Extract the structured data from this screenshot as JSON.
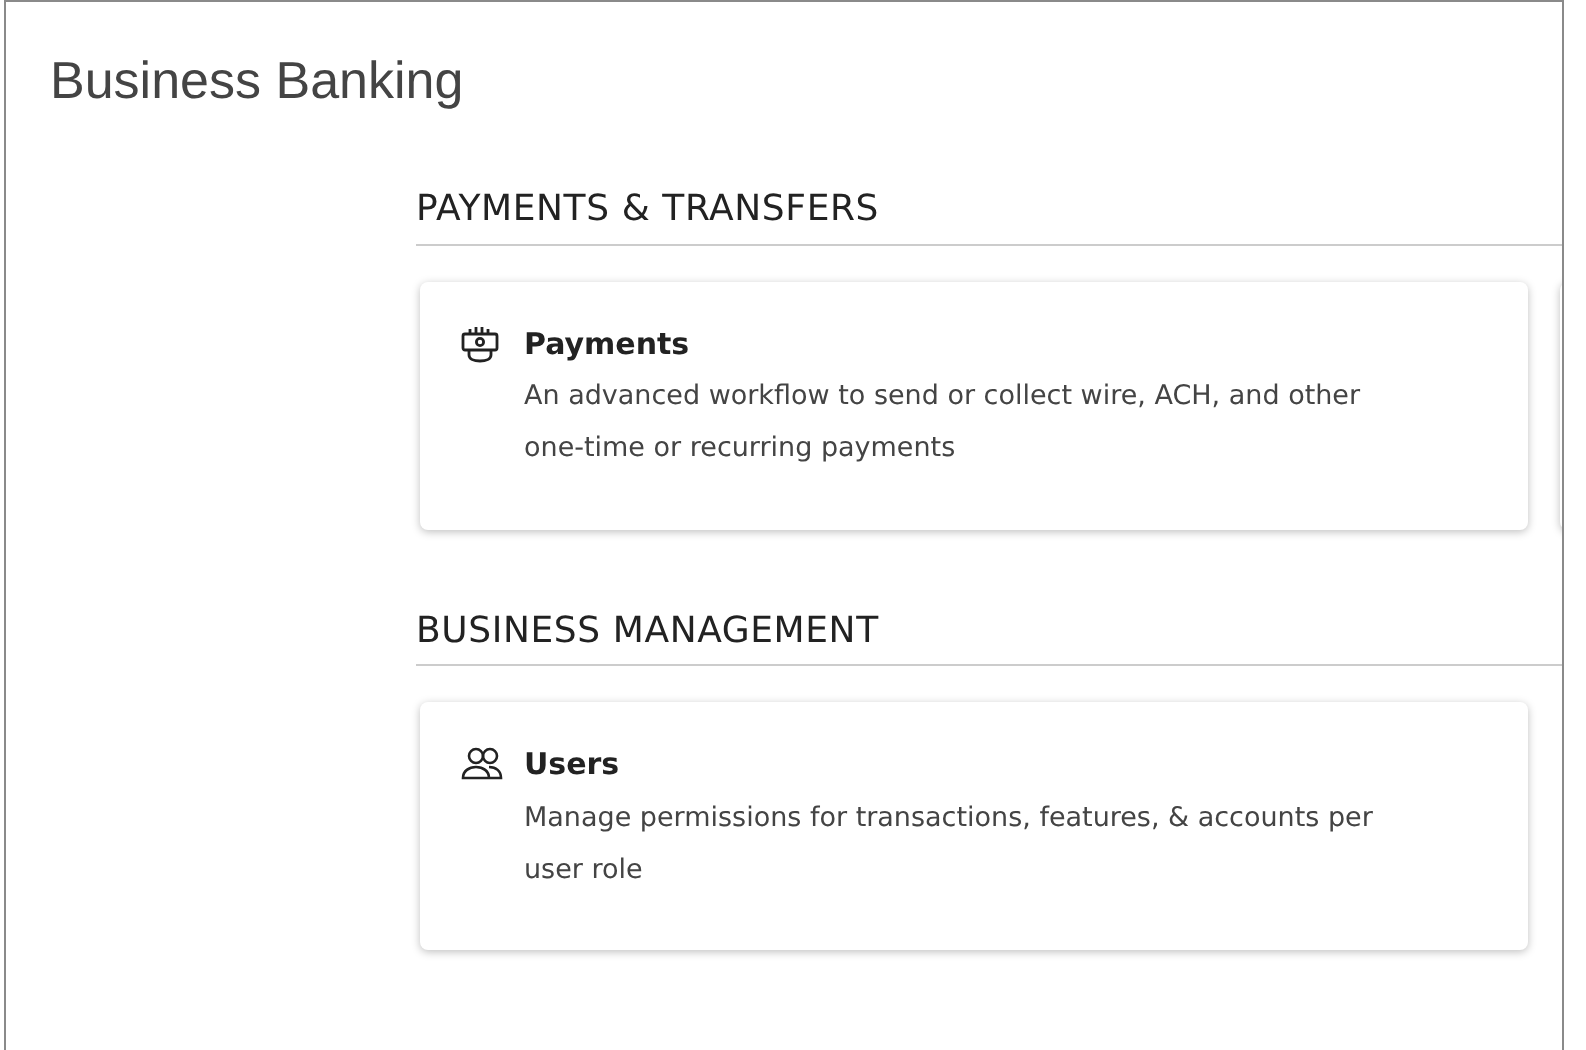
{
  "page_title": "Business Banking",
  "sections": [
    {
      "heading": "PAYMENTS & TRANSFERS",
      "cards": [
        {
          "kind": "payments",
          "title": "Payments",
          "description": "An advanced workflow to send or collect wire, ACH, and other one-time or recurring payments"
        },
        {
          "kind": "partial"
        }
      ]
    },
    {
      "heading": "BUSINESS MANAGEMENT",
      "cards": [
        {
          "kind": "users",
          "title": "Users",
          "description": "Manage permissions for transactions, features, & accounts per user role"
        }
      ]
    }
  ]
}
